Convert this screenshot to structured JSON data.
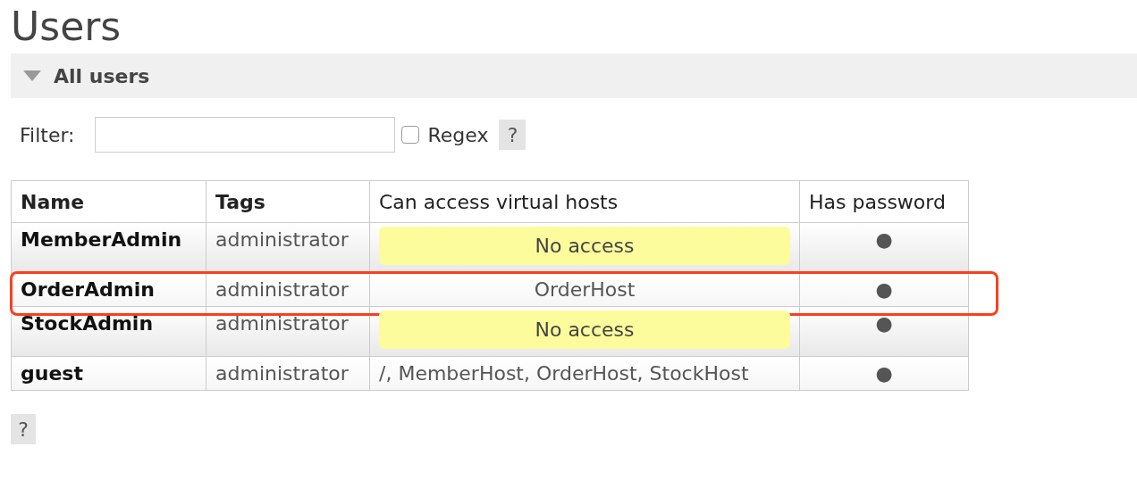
{
  "title": "Users",
  "section": {
    "title": "All users",
    "expanded": true
  },
  "filter": {
    "label": "Filter:",
    "regex_label": "Regex",
    "regex_checked": false,
    "help": "?"
  },
  "table": {
    "columns": [
      "Name",
      "Tags",
      "Can access virtual hosts",
      "Has password"
    ],
    "rows": [
      {
        "name": "MemberAdmin",
        "tags": "administrator",
        "vhosts": "No access",
        "no_access": true,
        "has_password": "●",
        "highlighted": false
      },
      {
        "name": "OrderAdmin",
        "tags": "administrator",
        "vhosts": "OrderHost",
        "no_access": false,
        "has_password": "●",
        "highlighted": true
      },
      {
        "name": "StockAdmin",
        "tags": "administrator",
        "vhosts": "No access",
        "no_access": true,
        "has_password": "●",
        "highlighted": false
      },
      {
        "name": "guest",
        "tags": "administrator",
        "vhosts": "/, MemberHost, OrderHost, StockHost",
        "no_access": false,
        "has_password": "●",
        "highlighted": false
      }
    ]
  },
  "footer_help": "?"
}
